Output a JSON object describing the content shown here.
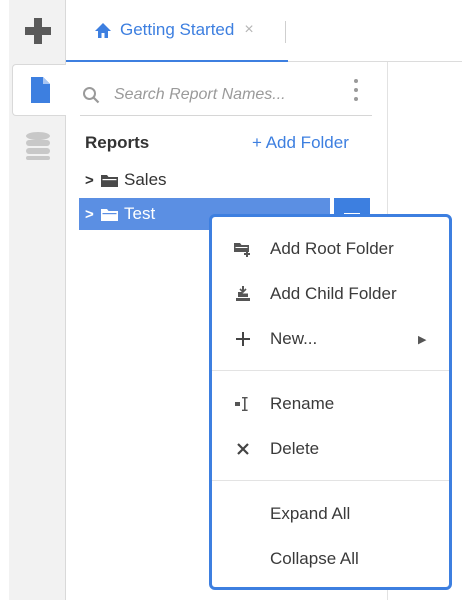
{
  "rail": {
    "add_icon": "plus-icon",
    "tabs": [
      {
        "icon": "document-icon",
        "active": true
      },
      {
        "icon": "database-icon",
        "active": false
      }
    ]
  },
  "tabs": [
    {
      "label": "Getting Started",
      "icon": "home-icon",
      "close": "×"
    }
  ],
  "search": {
    "placeholder": "Search Report Names..."
  },
  "reports": {
    "title": "Reports",
    "add_folder_label": "+ Add Folder",
    "tree": [
      {
        "label": "Sales",
        "chevron": ">"
      },
      {
        "label": "Test",
        "chevron": ">",
        "selected": true
      }
    ]
  },
  "context_menu": {
    "items": [
      {
        "label": "Add Root Folder",
        "icon": "add-root-folder-icon"
      },
      {
        "label": "Add Child Folder",
        "icon": "add-child-folder-icon"
      },
      {
        "label": "New...",
        "icon": "plus-icon",
        "submenu_arrow": "▶"
      },
      {
        "label": "Rename",
        "icon": "rename-icon"
      },
      {
        "label": "Delete",
        "icon": "close-icon"
      },
      {
        "label": "Expand All"
      },
      {
        "label": "Collapse All"
      }
    ]
  },
  "colors": {
    "accent": "#3d7fe0",
    "selected_row": "#5b8fe3"
  }
}
